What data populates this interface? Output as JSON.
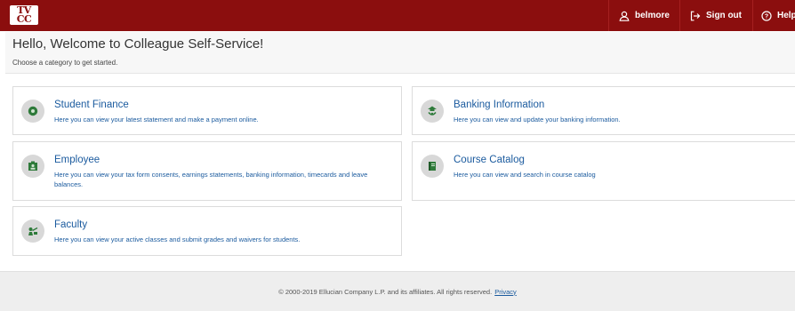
{
  "header": {
    "logo_text_top": "TV",
    "logo_text_bottom": "CC",
    "user_label": "belmore",
    "signout_label": "Sign out",
    "help_label": "Help",
    "bar_color": "#8b0e0e",
    "icons": {
      "user": "user-icon",
      "signout": "sign-out-icon",
      "help": "help-icon"
    }
  },
  "welcome": {
    "title": "Hello, Welcome to Colleague Self-Service!",
    "subtitle": "Choose a category to get started."
  },
  "categories": [
    {
      "title": "Student Finance",
      "description": "Here you can view your latest statement and make a payment online.",
      "icon": "money-icon"
    },
    {
      "title": "Employee",
      "description": "Here you can view your tax form consents, earnings statements, banking information, timecards and leave balances.",
      "icon": "employee-icon"
    },
    {
      "title": "Faculty",
      "description": "Here you can view your active classes and submit grades and waivers for students.",
      "icon": "faculty-icon"
    },
    {
      "title": "Banking Information",
      "description": "Here you can view and update your banking information.",
      "icon": "banking-icon"
    },
    {
      "title": "Course Catalog",
      "description": "Here you can view and search in course catalog",
      "icon": "catalog-icon"
    }
  ],
  "footer": {
    "copyright": "© 2000-2019 Ellucian Company L.P. and its affiliates. All rights reserved.",
    "privacy_link": "Privacy"
  }
}
